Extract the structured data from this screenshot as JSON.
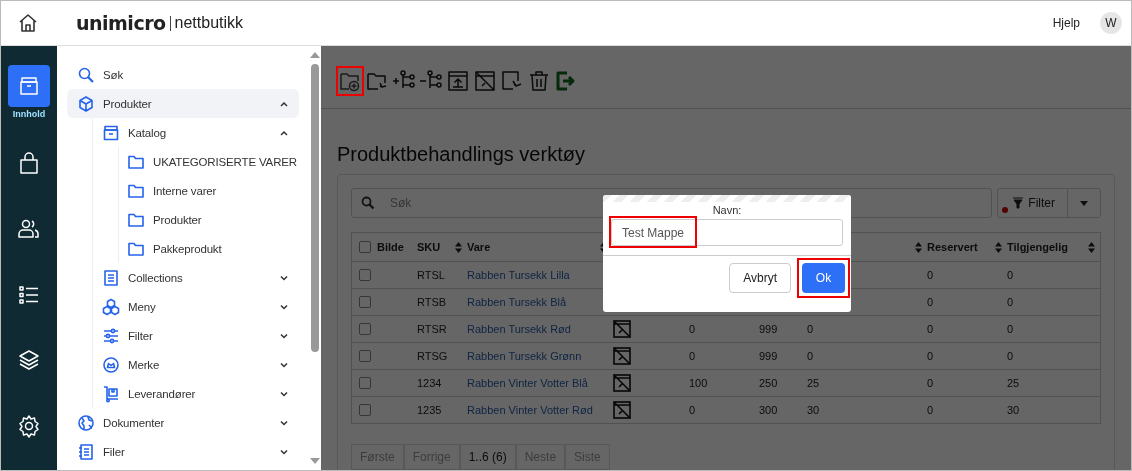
{
  "header": {
    "logo_primary": "unimicro",
    "logo_secondary": "nettbutikk",
    "help": "Hjelp",
    "avatar": "W"
  },
  "rail": [
    {
      "kind": "content",
      "label": "Innhold",
      "selected": true
    },
    {
      "kind": "bag",
      "selected": false
    },
    {
      "kind": "users",
      "selected": false
    },
    {
      "kind": "list",
      "selected": false
    },
    {
      "kind": "layers",
      "selected": false
    },
    {
      "kind": "settings",
      "selected": false
    }
  ],
  "sidebar": {
    "items": [
      {
        "kind": "search",
        "label": "Søk",
        "selected": false
      },
      {
        "kind": "box",
        "label": "Produkter",
        "selected": true,
        "expanded": true,
        "children": [
          {
            "kind": "catalog",
            "label": "Katalog",
            "selected": false,
            "expanded": true,
            "children": [
              {
                "kind": "folder",
                "label": "UKATEGORISERTE VARER",
                "selected": false
              },
              {
                "kind": "folder",
                "label": "Interne varer",
                "selected": false
              },
              {
                "kind": "folder",
                "label": "Produkter",
                "selected": false
              },
              {
                "kind": "folder",
                "label": "Pakkeprodukt",
                "selected": false
              }
            ]
          },
          {
            "kind": "collection",
            "label": "Collections",
            "selected": false,
            "expanded": false
          },
          {
            "kind": "cubes",
            "label": "Meny",
            "selected": false,
            "expanded": false
          },
          {
            "kind": "sliders",
            "label": "Filter",
            "selected": false,
            "expanded": false
          },
          {
            "kind": "badge",
            "label": "Merke",
            "selected": false,
            "expanded": false
          },
          {
            "kind": "cart",
            "label": "Leverandører",
            "selected": false,
            "expanded": false
          }
        ]
      },
      {
        "kind": "globe",
        "label": "Dokumenter",
        "selected": false,
        "expanded": false
      },
      {
        "kind": "notebook",
        "label": "Filer",
        "selected": false,
        "expanded": false
      }
    ]
  },
  "toolbar": [
    {
      "kind": "new-folder",
      "highlighted": true
    },
    {
      "kind": "move-folder",
      "highlighted": false
    },
    {
      "kind": "add-node",
      "highlighted": false
    },
    {
      "kind": "remove-node",
      "highlighted": false
    },
    {
      "kind": "upload-image",
      "highlighted": false
    },
    {
      "kind": "no-image",
      "highlighted": false
    },
    {
      "kind": "move-file",
      "highlighted": false
    },
    {
      "kind": "trash",
      "highlighted": false
    },
    {
      "kind": "exit",
      "highlighted": false
    }
  ],
  "page_title": "Produktbehandlings verktøy",
  "search": {
    "placeholder": "Søk"
  },
  "filter_button": {
    "label": "Filter",
    "active": true
  },
  "table": {
    "select_all_checked": false,
    "columns": [
      {
        "label": "Bilde",
        "sortable": false
      },
      {
        "label": "SKU",
        "sortable": true
      },
      {
        "label": "Vare",
        "sortable": true
      },
      {
        "sortable": true
      },
      {
        "label": "Reservert",
        "sortable": true
      },
      {
        "label": "Tilgjengelig",
        "sortable": true
      }
    ],
    "rows": [
      {
        "checked": false,
        "sku": "RTSL",
        "name": "Rabben Tursekk Lilla",
        "reservert": "0",
        "tilgjengelig": "0"
      },
      {
        "checked": false,
        "sku": "RTSB",
        "name": "Rabben Tursekk Blå",
        "reservert": "0",
        "tilgjengelig": "0"
      },
      {
        "checked": false,
        "sku": "RTSR",
        "name": "Rabben Tursekk Rød",
        "no_image": true,
        "column_5": "0",
        "column_6": "999",
        "column_7": "0",
        "reservert": "0",
        "tilgjengelig": "0"
      },
      {
        "checked": false,
        "sku": "RTSG",
        "name": "Rabben Tursekk Grønn",
        "no_image": true,
        "column_5": "0",
        "column_6": "999",
        "column_7": "0",
        "reservert": "0",
        "tilgjengelig": "0"
      },
      {
        "checked": false,
        "sku": "1234",
        "name": "Rabben Vinter Votter Blå",
        "no_image": true,
        "column_5": "100",
        "column_6": "250",
        "column_7": "25",
        "reservert": "0",
        "tilgjengelig": "25"
      },
      {
        "checked": false,
        "sku": "1235",
        "name": "Rabben Vinter Votter Rød",
        "no_image": true,
        "column_5": "0",
        "column_6": "300",
        "column_7": "30",
        "reservert": "0",
        "tilgjengelig": "30"
      }
    ]
  },
  "pagination": [
    {
      "label": "Første",
      "disabled": true
    },
    {
      "label": "Forrige",
      "disabled": true
    },
    {
      "label": "1..6 (6)",
      "disabled": false
    },
    {
      "label": "Neste",
      "disabled": true
    },
    {
      "label": "Siste",
      "disabled": true
    }
  ],
  "dialog": {
    "label": "Navn:",
    "value": "Test Mappe",
    "value_highlighted": true,
    "buttons": [
      {
        "kind": "secondary",
        "label": "Avbryt",
        "highlighted": false
      },
      {
        "kind": "primary",
        "label": "Ok",
        "highlighted": true
      }
    ]
  }
}
